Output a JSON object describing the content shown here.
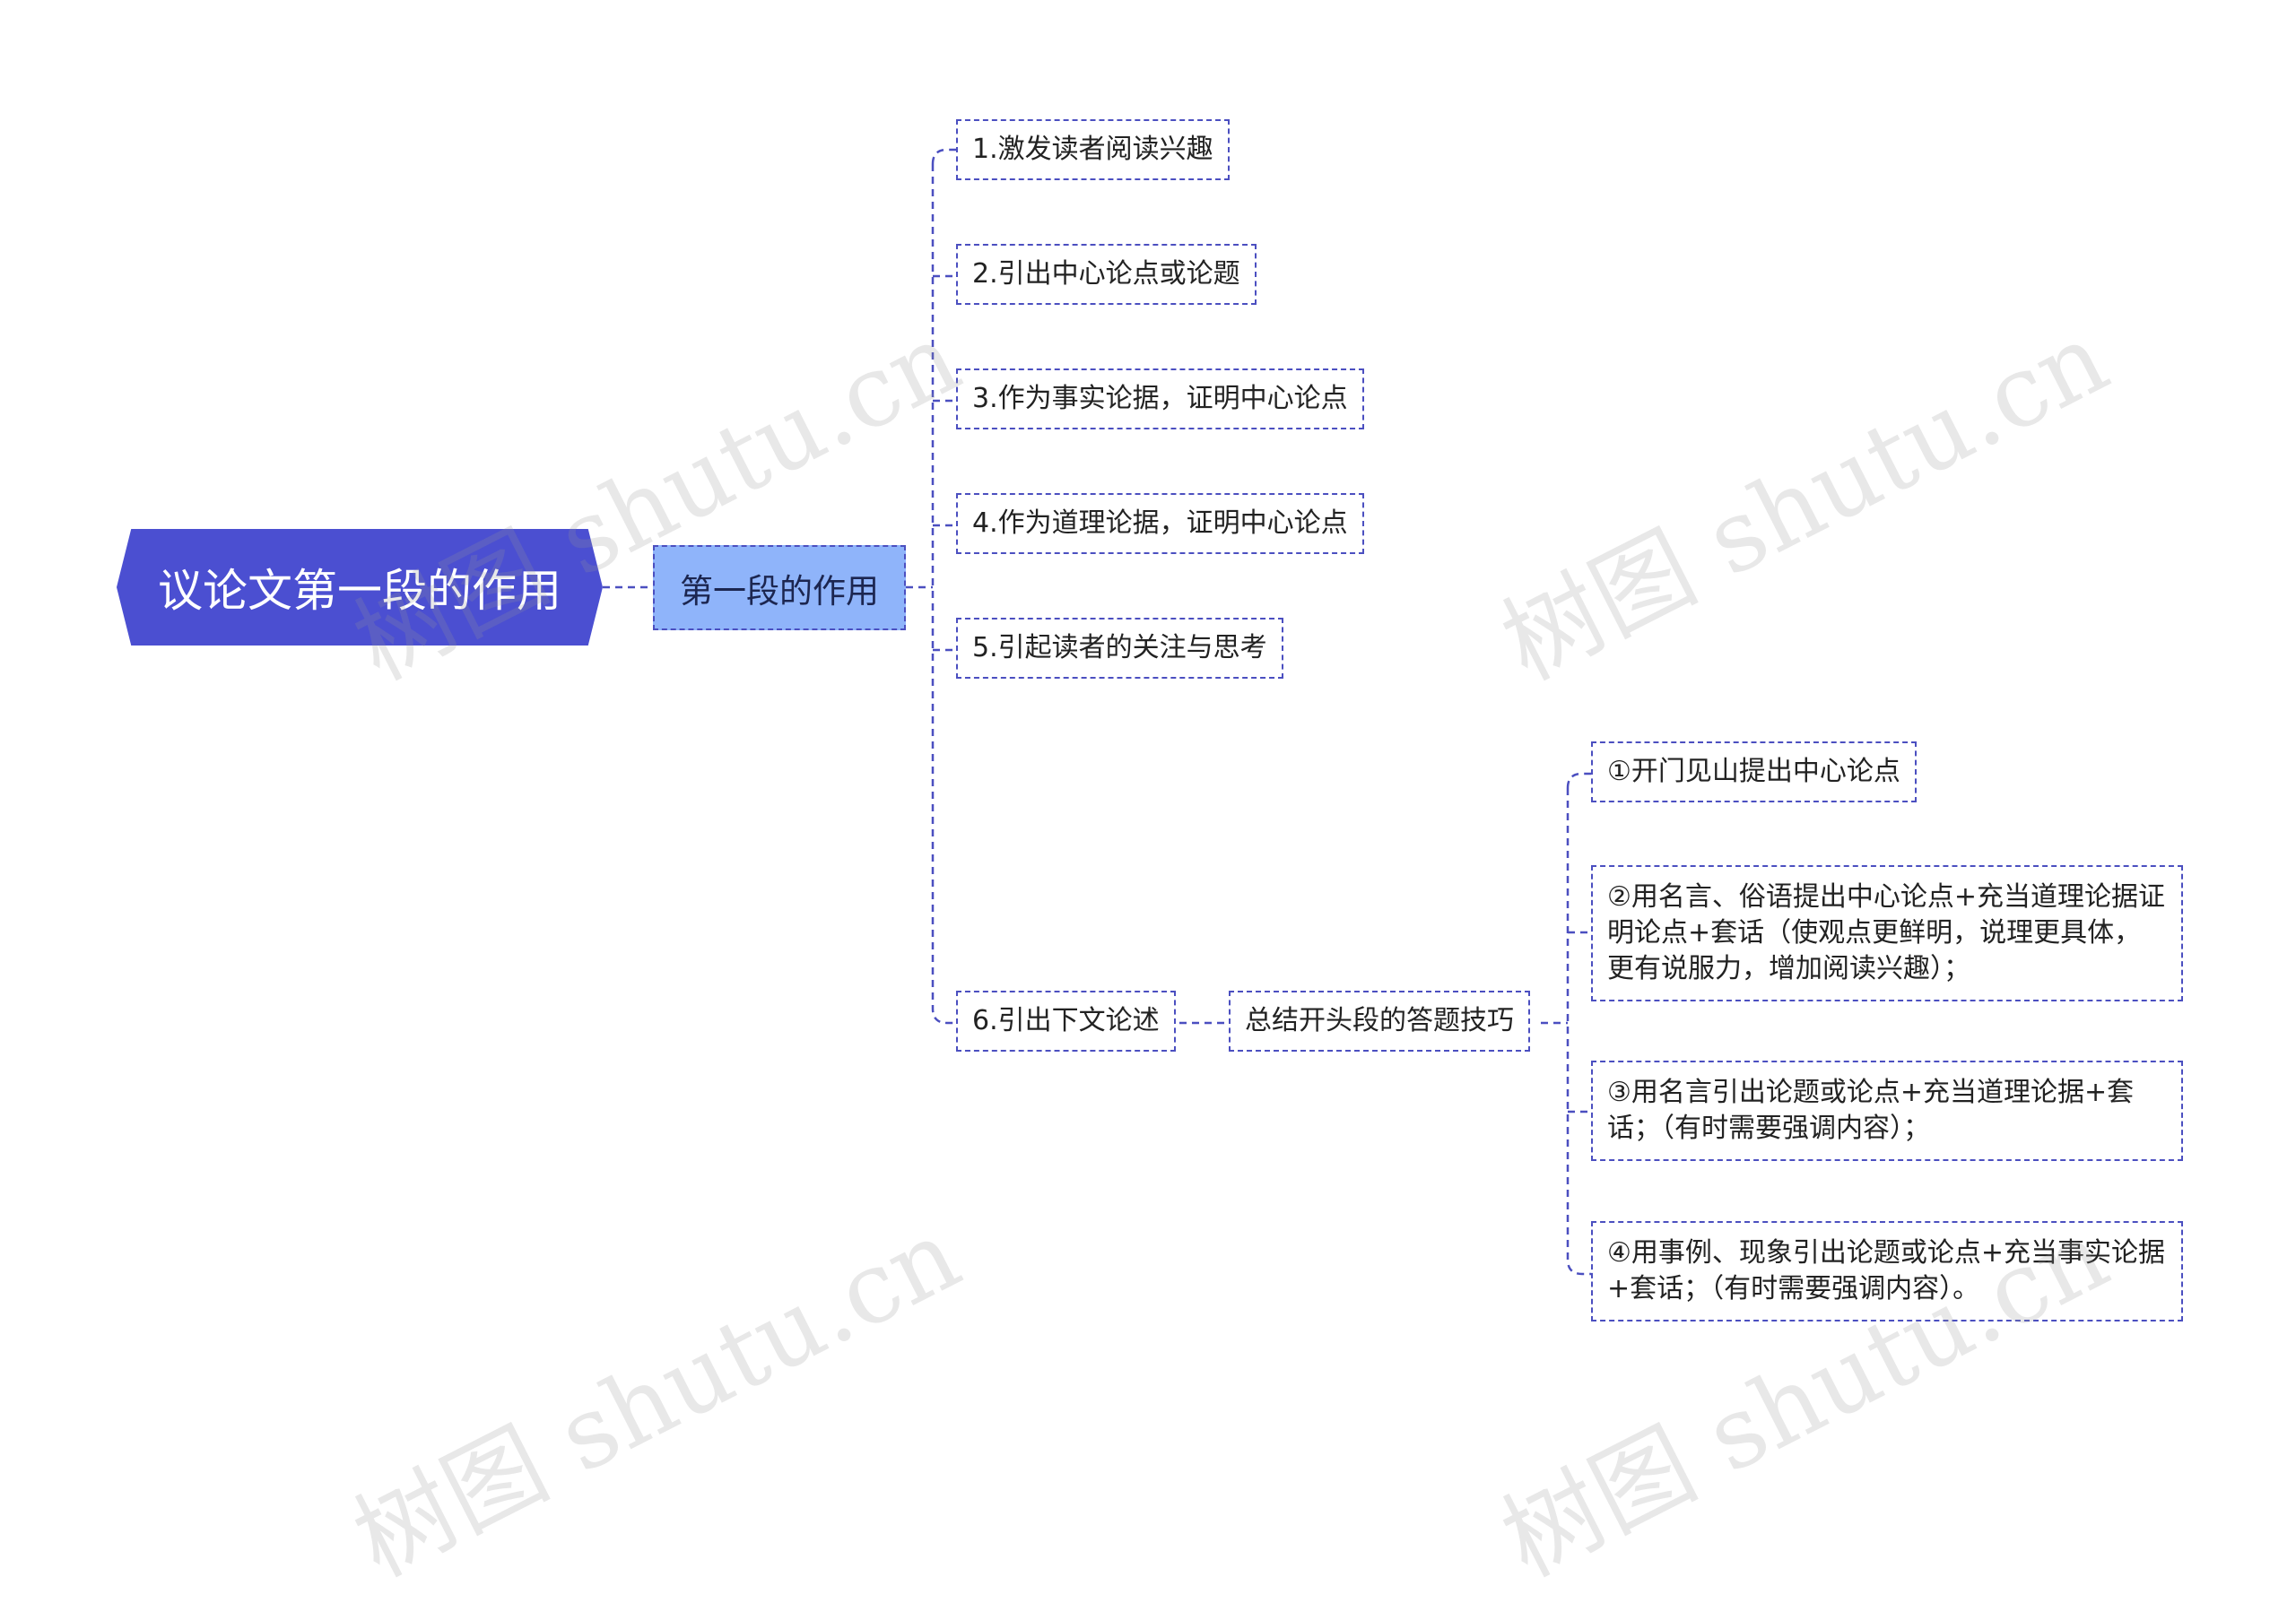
{
  "root": {
    "label": "议论文第一段的作用"
  },
  "level1": {
    "label": "第一段的作用"
  },
  "items": [
    {
      "label": "1.激发读者阅读兴趣"
    },
    {
      "label": "2.引出中心论点或论题"
    },
    {
      "label": "3.作为事实论据，证明中心论点"
    },
    {
      "label": "4.作为道理论据，证明中心论点"
    },
    {
      "label": "5.引起读者的关注与思考"
    },
    {
      "label": "6.引出下文论述"
    }
  ],
  "summary": {
    "label": "总结开头段的答题技巧"
  },
  "techniques": [
    {
      "label": "①开门见山提出中心论点"
    },
    {
      "label": "②用名言、俗语提出中心论点+充当道理论据证明论点+套话（使观点更鲜明，说理更具体，更有说服力，增加阅读兴趣）；"
    },
    {
      "label": "③用名言引出论题或论点+充当道理论据+套话；（有时需要强调内容）；"
    },
    {
      "label": "④用事例、现象引出论题或论点+充当事实论据+套话；（有时需要强调内容）。"
    }
  ],
  "watermark": "树图 shutu.cn",
  "colors": {
    "root": "#4b4fd1",
    "level1": "#8fb4fa",
    "line": "#4b4fc0"
  }
}
